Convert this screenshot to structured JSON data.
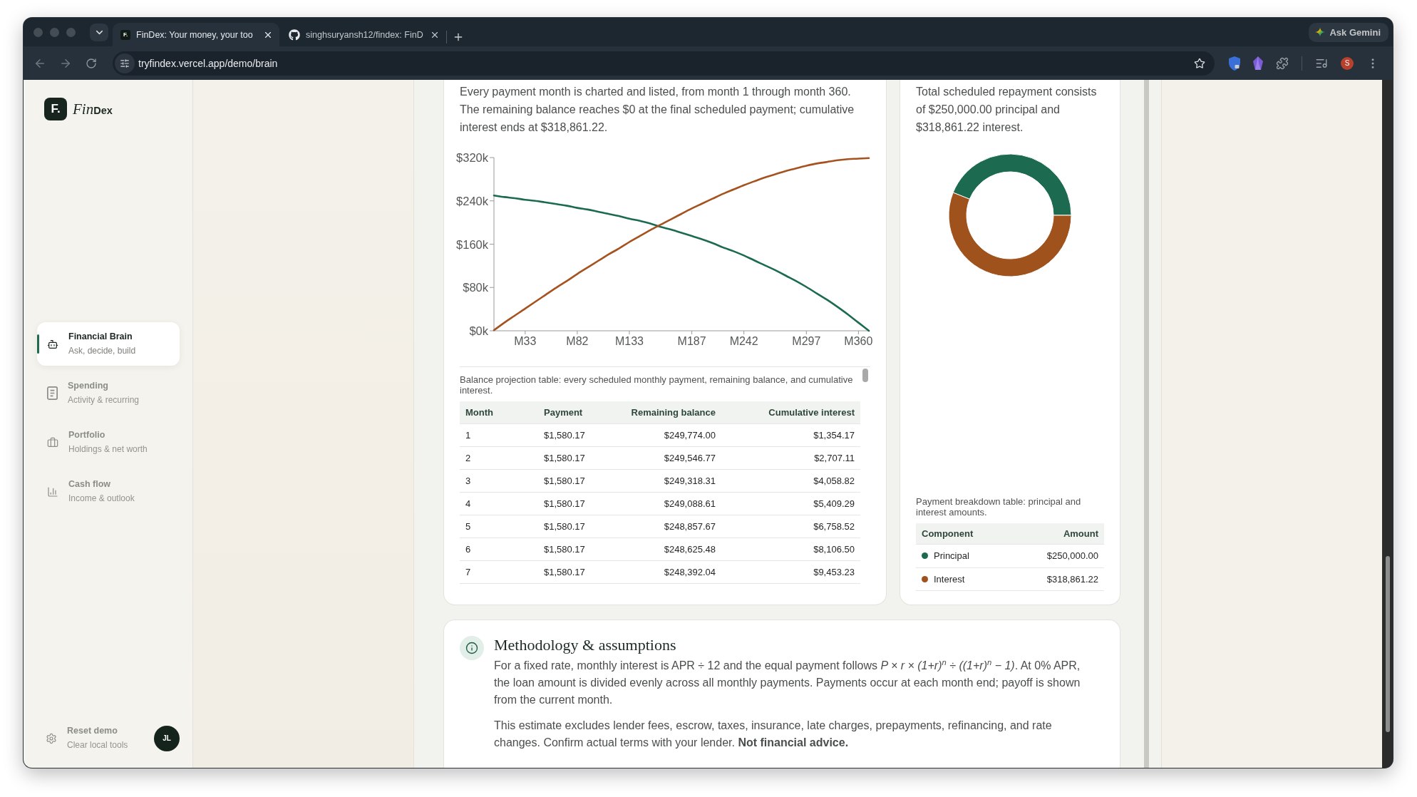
{
  "browser": {
    "tabs": [
      {
        "kind": "letter",
        "favicon": "F.",
        "title": "FinDex: Your money, your too",
        "selected": true
      },
      {
        "kind": "logo",
        "title": "singhsuryansh12/findex: FinD",
        "selected": false
      }
    ],
    "gemini_button": "Ask Gemini",
    "url": "tryfindex.vercel.app/demo/brain",
    "profile_initial": "S"
  },
  "sidebar": {
    "logo": {
      "mark": "F.",
      "name_start": "Fin",
      "name_end": "Dex"
    },
    "items": [
      {
        "title": "Financial Brain",
        "subtitle": "Ask, decide, build",
        "selected": true
      },
      {
        "title": "Spending",
        "subtitle": "Activity & recurring",
        "selected": false
      },
      {
        "title": "Portfolio",
        "subtitle": "Holdings & net worth",
        "selected": false
      },
      {
        "title": "Cash flow",
        "subtitle": "Income & outlook",
        "selected": false
      }
    ],
    "footer": {
      "title": "Reset demo",
      "subtitle": "Clear local tools",
      "avatar": "JL"
    }
  },
  "balance_card": {
    "description": "Every payment month is charted and listed, from month 1 through month 360. The remaining balance reaches $0 at the final scheduled payment; cumulative interest ends at $318,861.22.",
    "chart_data": {
      "type": "line",
      "categories": [
        null,
        null,
        null,
        "M33",
        null,
        null,
        null,
        null,
        "M82",
        null,
        null,
        null,
        null,
        "M133",
        null,
        null,
        null,
        null,
        null,
        "M187",
        null,
        null,
        null,
        null,
        "M242",
        null,
        null,
        null,
        null,
        null,
        "M297",
        null,
        null,
        null,
        null,
        "M360",
        null
      ],
      "series": [
        {
          "color": "#1c6b51",
          "values": [
            250000,
            247000,
            245000,
            242000,
            240000,
            237000,
            234000,
            231000,
            227000,
            224000,
            220000,
            216000,
            212000,
            207000,
            203000,
            198000,
            192000,
            187000,
            181000,
            175000,
            169000,
            162000,
            154000,
            147000,
            139000,
            130000,
            121000,
            112000,
            102000,
            92000,
            81000,
            69000,
            57000,
            44000,
            30000,
            15000,
            0
          ]
        },
        {
          "color": "#a5521f",
          "values": [
            1000,
            15000,
            28000,
            41000,
            54000,
            67000,
            80000,
            92000,
            105000,
            117000,
            129000,
            141000,
            152000,
            164000,
            175000,
            186000,
            196000,
            206000,
            216000,
            226000,
            235000,
            244000,
            253000,
            261000,
            269000,
            276000,
            283000,
            289000,
            295000,
            300000,
            305000,
            309000,
            312000,
            315000,
            317000,
            318000,
            319000
          ]
        }
      ],
      "ylim": [
        0,
        320000
      ],
      "yticks": [
        {
          "value": 0,
          "label": "$0k"
        },
        {
          "value": 80000,
          "label": "$80k"
        },
        {
          "value": 160000,
          "label": "$160k"
        },
        {
          "value": 240000,
          "label": "$240k"
        },
        {
          "value": 320000,
          "label": "$320k"
        }
      ]
    },
    "table": {
      "caption": "Balance projection table: every scheduled monthly payment, remaining balance, and cumulative interest.",
      "columns": [
        "Month",
        "Payment",
        "Remaining balance",
        "Cumulative interest"
      ],
      "rows": [
        [
          "1",
          "$1,580.17",
          "$249,774.00",
          "$1,354.17"
        ],
        [
          "2",
          "$1,580.17",
          "$249,546.77",
          "$2,707.11"
        ],
        [
          "3",
          "$1,580.17",
          "$249,318.31",
          "$4,058.82"
        ],
        [
          "4",
          "$1,580.17",
          "$249,088.61",
          "$5,409.29"
        ],
        [
          "5",
          "$1,580.17",
          "$248,857.67",
          "$6,758.52"
        ],
        [
          "6",
          "$1,580.17",
          "$248,625.48",
          "$8,106.50"
        ],
        [
          "7",
          "$1,580.17",
          "$248,392.04",
          "$9,453.23"
        ]
      ]
    }
  },
  "breakdown_card": {
    "description": "Total scheduled repayment consists of $250,000.00 principal and $318,861.22 interest.",
    "chart_data": {
      "type": "donut",
      "values": [
        43.95,
        56.05
      ],
      "colors": [
        "#1c6a50",
        "#a0521c"
      ]
    },
    "table": {
      "caption": "Payment breakdown table: principal and interest amounts.",
      "columns": [
        "Component",
        "Amount"
      ],
      "rows": [
        {
          "component": "Principal",
          "amount": "$250,000.00",
          "color": "#1c6a50"
        },
        {
          "component": "Interest",
          "amount": "$318,861.22",
          "color": "#a0521c"
        }
      ]
    }
  },
  "methodology": {
    "title": "Methodology & assumptions",
    "paragraphs": [
      "For a fixed rate, monthly interest is APR ÷ 12 and the equal payment follows *P × r × (1+r)$^{n}$ ÷ ((1+r)$^{n}$ − 1)*. At 0% APR, the loan amount is divided evenly across all monthly payments. Payments occur at each month end; payoff is shown from the current month.",
      "This estimate excludes lender fees, escrow, taxes, insurance, late charges, prepayments, refinancing, and rate changes. Confirm actual terms with your lender. **Not financial advice.**"
    ]
  }
}
